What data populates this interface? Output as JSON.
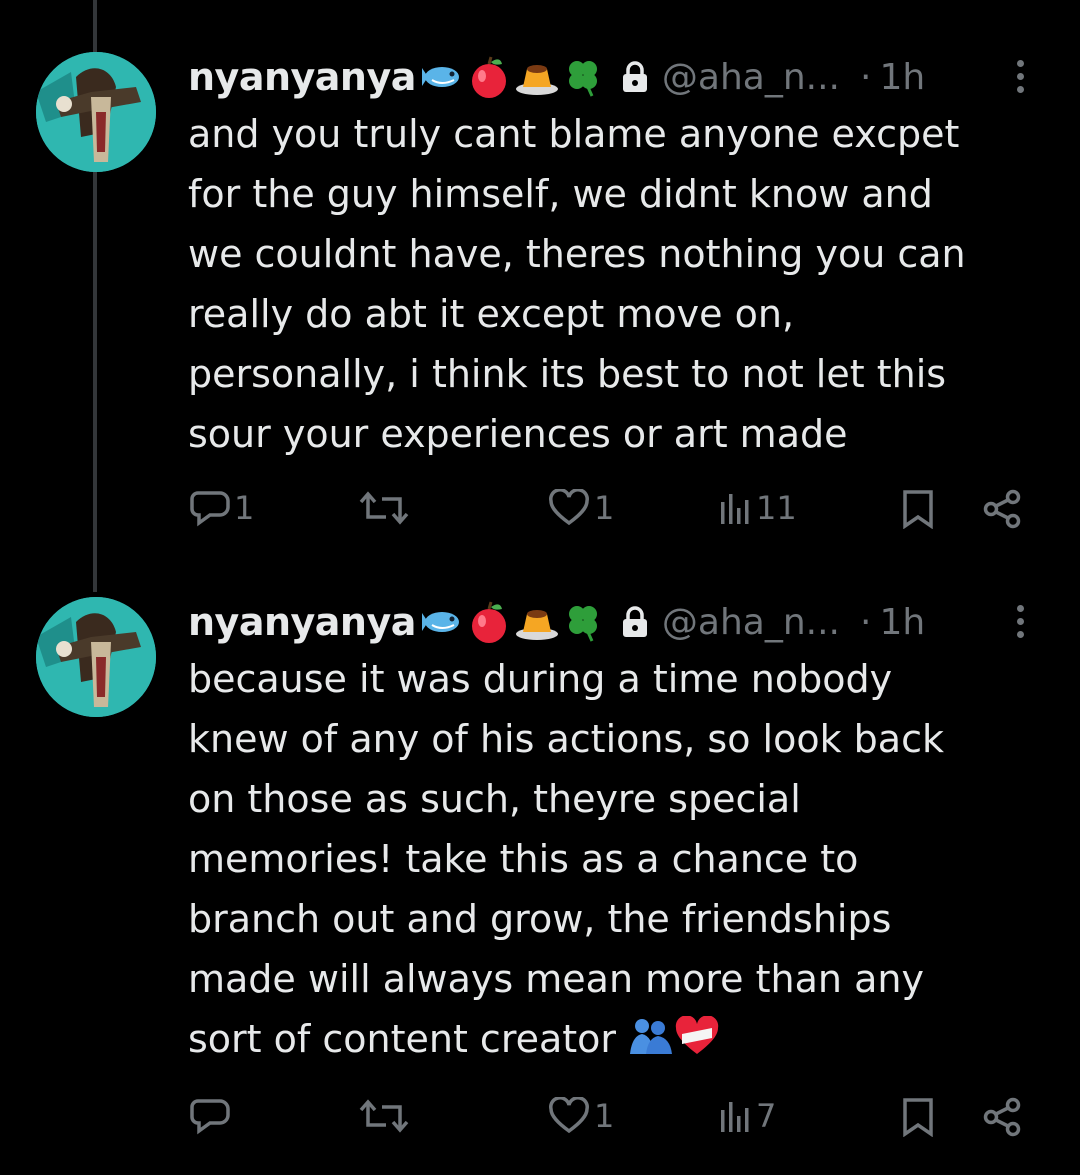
{
  "tweets": [
    {
      "display_name": "nyanyanya",
      "handle": "@aha_n...",
      "separator": "·",
      "time": "1h",
      "text": "and you truly cant blame anyone excpet\nfor the guy himself, we didnt know and\nwe couldnt have, theres nothing you can\nreally do abt it except move on,\npersonally, i think its best to not let this\nsour your experiences or art made",
      "reply_count": "1",
      "retweet_count": "",
      "like_count": "1",
      "view_count": "11",
      "name_emojis": [
        "fish-icon",
        "apple-icon",
        "pudding-icon",
        "clover-icon"
      ],
      "text_emojis": []
    },
    {
      "display_name": "nyanyanya",
      "handle": "@aha_n...",
      "separator": "·",
      "time": "1h",
      "text": "because it was during a time nobody\nknew of any of his actions, so look back\non those as such, theyre special\nmemories! take this as a chance to\nbranch out and grow, the friendships\nmade will always mean more than any\nsort of content creator ",
      "reply_count": "",
      "retweet_count": "",
      "like_count": "1",
      "view_count": "7",
      "name_emojis": [
        "fish-icon",
        "apple-icon",
        "pudding-icon",
        "clover-icon"
      ],
      "text_emojis": [
        "hugging-people-icon",
        "mending-heart-icon"
      ]
    }
  ],
  "colors": {
    "background": "#000000",
    "text": "#e7e9ea",
    "muted": "#71767b",
    "thread_line": "#333639",
    "avatar_bg": "#2fb7b0"
  }
}
